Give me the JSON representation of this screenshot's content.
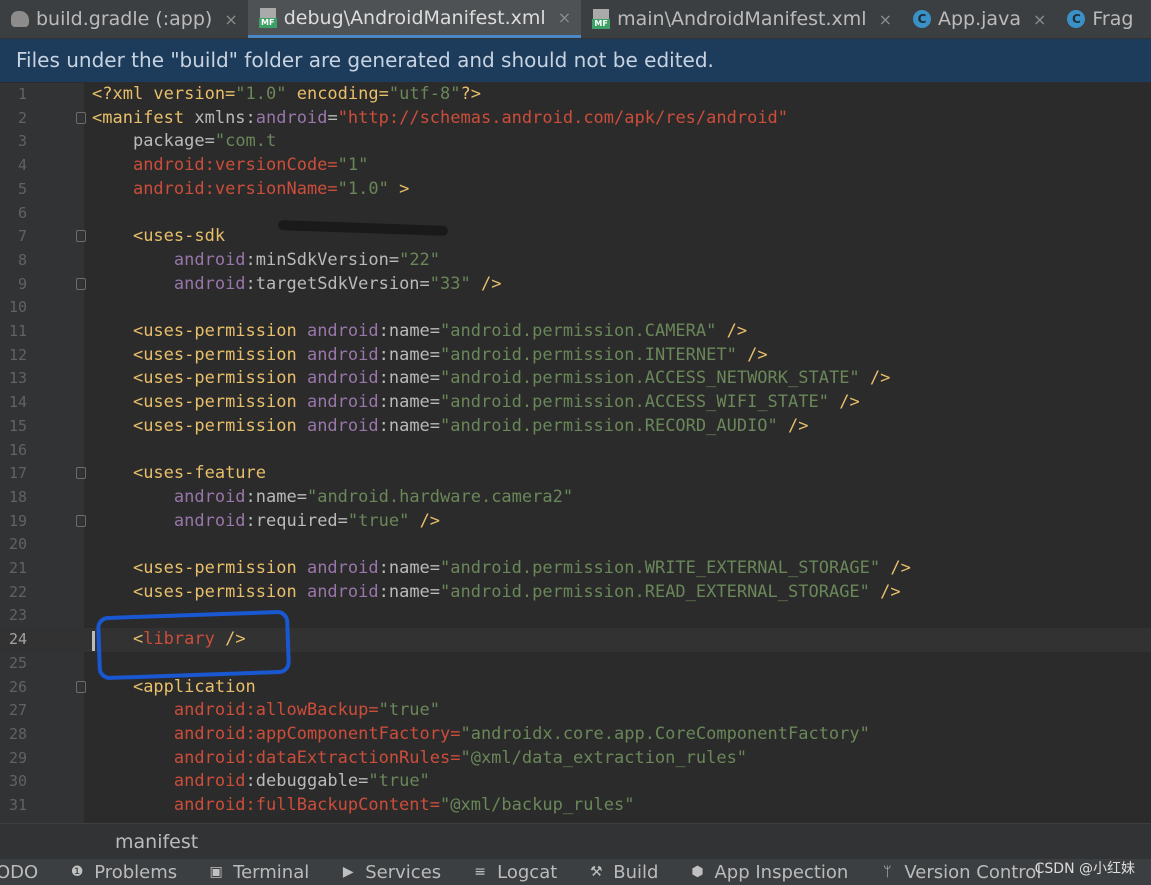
{
  "tabs": [
    {
      "icon": "gradle-elephant-icon",
      "label": "build.gradle (:app)",
      "active": false
    },
    {
      "icon": "manifest-file-icon",
      "label": "debug\\AndroidManifest.xml",
      "active": true
    },
    {
      "icon": "manifest-file-icon",
      "label": "main\\AndroidManifest.xml",
      "active": false
    },
    {
      "icon": "java-class-icon",
      "label": "App.java",
      "active": false
    },
    {
      "icon": "java-class-icon",
      "label": "Frag",
      "active": false
    }
  ],
  "tab_close_glyph": "×",
  "mf_badge": "MF",
  "class_badge": "C",
  "banner": "Files under the \"build\" folder are generated and should not be edited.",
  "lines": [
    {
      "n": "1",
      "segs": [
        [
          "dec",
          "<?xml version="
        ],
        [
          "str",
          "\"1.0\""
        ],
        [
          "dec",
          " encoding="
        ],
        [
          "str",
          "\"utf-8\""
        ],
        [
          "dec",
          "?>"
        ]
      ]
    },
    {
      "n": "2",
      "fold": true,
      "segs": [
        [
          "tag",
          "<manifest "
        ],
        [
          "at",
          "xmlns:"
        ],
        [
          "ns",
          "android"
        ],
        [
          "at",
          "="
        ],
        [
          "red",
          "\"http://schemas.android.com/apk/res/android\""
        ]
      ]
    },
    {
      "n": "3",
      "segs": [
        [
          "pl",
          "    "
        ],
        [
          "at",
          "package="
        ],
        [
          "str",
          "\"com.t"
        ]
      ]
    },
    {
      "n": "4",
      "segs": [
        [
          "pl",
          "    "
        ],
        [
          "red",
          "android:versionCode="
        ],
        [
          "str",
          "\"1\""
        ]
      ]
    },
    {
      "n": "5",
      "segs": [
        [
          "pl",
          "    "
        ],
        [
          "red",
          "android:versionName="
        ],
        [
          "str",
          "\"1.0\""
        ],
        [
          "tag",
          " >"
        ]
      ]
    },
    {
      "n": "6",
      "segs": []
    },
    {
      "n": "7",
      "fold": true,
      "segs": [
        [
          "pl",
          "    "
        ],
        [
          "tag",
          "<uses-sdk"
        ]
      ]
    },
    {
      "n": "8",
      "segs": [
        [
          "pl",
          "        "
        ],
        [
          "ns",
          "android"
        ],
        [
          "at",
          ":minSdkVersion="
        ],
        [
          "str",
          "\"22\""
        ]
      ]
    },
    {
      "n": "9",
      "fold": true,
      "segs": [
        [
          "pl",
          "        "
        ],
        [
          "ns",
          "android"
        ],
        [
          "at",
          ":targetSdkVersion="
        ],
        [
          "str",
          "\"33\""
        ],
        [
          "tag",
          " />"
        ]
      ]
    },
    {
      "n": "10",
      "segs": []
    },
    {
      "n": "11",
      "segs": [
        [
          "pl",
          "    "
        ],
        [
          "tag",
          "<uses-permission "
        ],
        [
          "ns",
          "android"
        ],
        [
          "at",
          ":name="
        ],
        [
          "str",
          "\"android.permission.CAMERA\""
        ],
        [
          "tag",
          " />"
        ]
      ]
    },
    {
      "n": "12",
      "segs": [
        [
          "pl",
          "    "
        ],
        [
          "tag",
          "<uses-permission "
        ],
        [
          "ns",
          "android"
        ],
        [
          "at",
          ":name="
        ],
        [
          "str",
          "\"android.permission.INTERNET\""
        ],
        [
          "tag",
          " />"
        ]
      ]
    },
    {
      "n": "13",
      "segs": [
        [
          "pl",
          "    "
        ],
        [
          "tag",
          "<uses-permission "
        ],
        [
          "ns",
          "android"
        ],
        [
          "at",
          ":name="
        ],
        [
          "str",
          "\"android.permission.ACCESS_NETWORK_STATE\""
        ],
        [
          "tag",
          " />"
        ]
      ]
    },
    {
      "n": "14",
      "segs": [
        [
          "pl",
          "    "
        ],
        [
          "tag",
          "<uses-permission "
        ],
        [
          "ns",
          "android"
        ],
        [
          "at",
          ":name="
        ],
        [
          "str",
          "\"android.permission.ACCESS_WIFI_STATE\""
        ],
        [
          "tag",
          " />"
        ]
      ]
    },
    {
      "n": "15",
      "segs": [
        [
          "pl",
          "    "
        ],
        [
          "tag",
          "<uses-permission "
        ],
        [
          "ns",
          "android"
        ],
        [
          "at",
          ":name="
        ],
        [
          "str",
          "\"android.permission.RECORD_AUDIO\""
        ],
        [
          "tag",
          " />"
        ]
      ]
    },
    {
      "n": "16",
      "segs": []
    },
    {
      "n": "17",
      "fold": true,
      "segs": [
        [
          "pl",
          "    "
        ],
        [
          "tag",
          "<uses-feature"
        ]
      ]
    },
    {
      "n": "18",
      "segs": [
        [
          "pl",
          "        "
        ],
        [
          "ns",
          "android"
        ],
        [
          "at",
          ":name="
        ],
        [
          "str",
          "\"android.hardware.camera2\""
        ]
      ]
    },
    {
      "n": "19",
      "fold": true,
      "segs": [
        [
          "pl",
          "        "
        ],
        [
          "ns",
          "android"
        ],
        [
          "at",
          ":required="
        ],
        [
          "str",
          "\"true\""
        ],
        [
          "tag",
          " />"
        ]
      ]
    },
    {
      "n": "20",
      "segs": []
    },
    {
      "n": "21",
      "segs": [
        [
          "pl",
          "    "
        ],
        [
          "tag",
          "<uses-permission "
        ],
        [
          "ns",
          "android"
        ],
        [
          "at",
          ":name="
        ],
        [
          "str",
          "\"android.permission.WRITE_EXTERNAL_STORAGE\""
        ],
        [
          "tag",
          " />"
        ]
      ]
    },
    {
      "n": "22",
      "segs": [
        [
          "pl",
          "    "
        ],
        [
          "tag",
          "<uses-permission "
        ],
        [
          "ns",
          "android"
        ],
        [
          "at",
          ":name="
        ],
        [
          "str",
          "\"android.permission.READ_EXTERNAL_STORAGE\""
        ],
        [
          "tag",
          " />"
        ]
      ]
    },
    {
      "n": "23",
      "segs": []
    },
    {
      "n": "24",
      "current": true,
      "segs": [
        [
          "pl",
          "    "
        ],
        [
          "tag",
          "<"
        ],
        [
          "red",
          "library"
        ],
        [
          "tag",
          " />"
        ]
      ]
    },
    {
      "n": "25",
      "segs": []
    },
    {
      "n": "26",
      "fold": true,
      "segs": [
        [
          "pl",
          "    "
        ],
        [
          "tag",
          "<application"
        ]
      ]
    },
    {
      "n": "27",
      "segs": [
        [
          "pl",
          "        "
        ],
        [
          "red",
          "android:allowBackup="
        ],
        [
          "str",
          "\"true\""
        ]
      ]
    },
    {
      "n": "28",
      "segs": [
        [
          "pl",
          "        "
        ],
        [
          "red",
          "android:appComponentFactory="
        ],
        [
          "str",
          "\"androidx.core.app.CoreComponentFactory\""
        ]
      ]
    },
    {
      "n": "29",
      "segs": [
        [
          "pl",
          "        "
        ],
        [
          "red",
          "android:dataExtractionRules="
        ],
        [
          "str",
          "\"@xml/data_extraction_rules\""
        ]
      ]
    },
    {
      "n": "30",
      "segs": [
        [
          "pl",
          "        "
        ],
        [
          "red",
          "android"
        ],
        [
          "at",
          ":debuggable="
        ],
        [
          "str",
          "\"true\""
        ]
      ]
    },
    {
      "n": "31",
      "segs": [
        [
          "pl",
          "        "
        ],
        [
          "red",
          "android:fullBackupContent="
        ],
        [
          "str",
          "\"@xml/backup_rules\""
        ]
      ]
    }
  ],
  "breadcrumb": "manifest",
  "toolbar": [
    {
      "icon": "",
      "label": "ODO"
    },
    {
      "icon": "problems-icon",
      "label": "Problems"
    },
    {
      "icon": "terminal-icon",
      "label": "Terminal"
    },
    {
      "icon": "services-icon",
      "label": "Services"
    },
    {
      "icon": "logcat-icon",
      "label": "Logcat"
    },
    {
      "icon": "build-hammer-icon",
      "label": "Build"
    },
    {
      "icon": "app-inspection-icon",
      "label": "App Inspection"
    },
    {
      "icon": "version-control-icon",
      "label": "Version Control"
    }
  ],
  "toolbar_glyphs": {
    "problems-icon": "❶",
    "terminal-icon": "▣",
    "services-icon": "▶",
    "logcat-icon": "≡",
    "build-hammer-icon": "⚒",
    "app-inspection-icon": "⬢",
    "version-control-icon": "ᛘ"
  },
  "watermark": "CSDN @小红妹"
}
